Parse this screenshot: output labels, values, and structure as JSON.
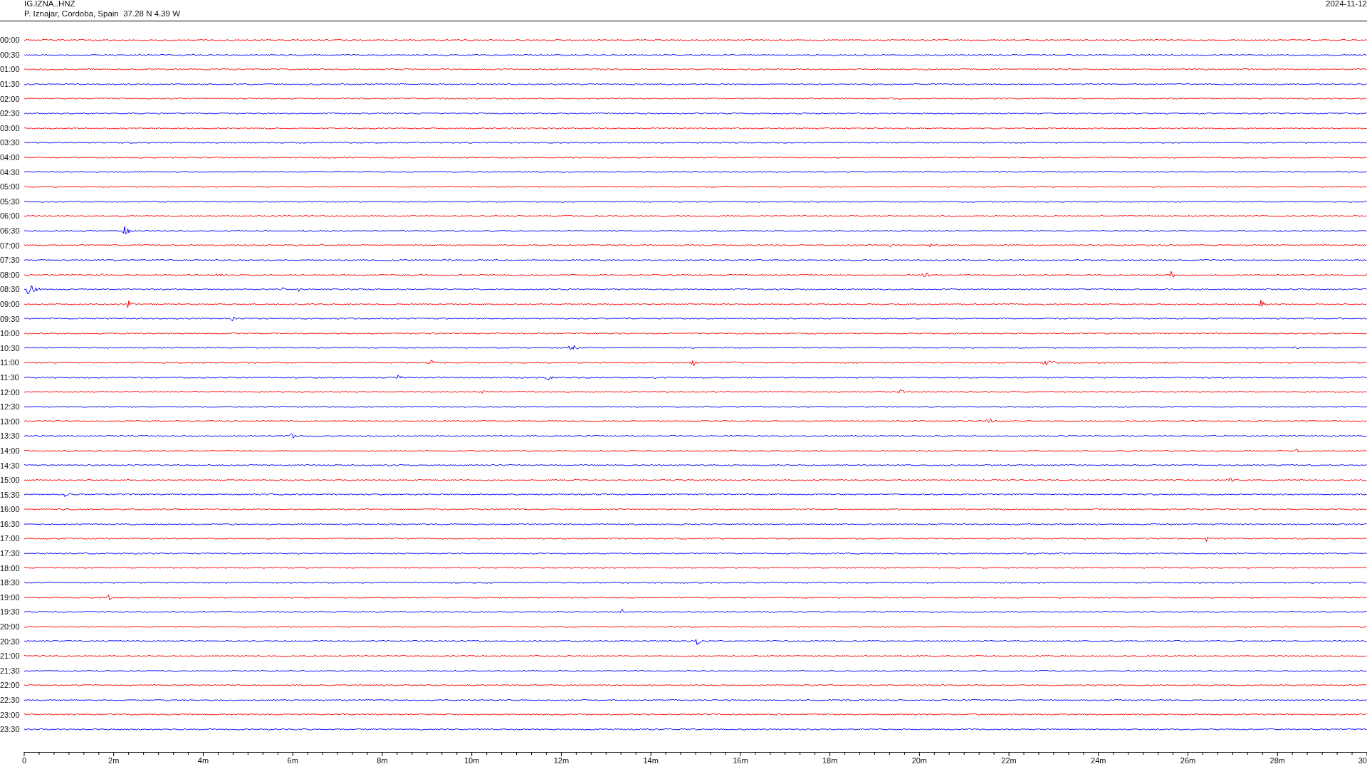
{
  "header": {
    "station": "IG.IZNA..HNZ",
    "location": "P. Iznajar, Cordoba, Spain  37.28 N 4.39 W",
    "date": "2024-11-12"
  },
  "rows": [
    {
      "time": "00:00",
      "color": "#ff0000"
    },
    {
      "time": "00:30",
      "color": "#0000ff"
    },
    {
      "time": "01:00",
      "color": "#ff0000"
    },
    {
      "time": "01:30",
      "color": "#0000ff"
    },
    {
      "time": "02:00",
      "color": "#ff0000"
    },
    {
      "time": "02:30",
      "color": "#0000ff"
    },
    {
      "time": "03:00",
      "color": "#ff0000"
    },
    {
      "time": "03:30",
      "color": "#0000ff"
    },
    {
      "time": "04:00",
      "color": "#ff0000"
    },
    {
      "time": "04:30",
      "color": "#0000ff"
    },
    {
      "time": "05:00",
      "color": "#ff0000"
    },
    {
      "time": "05:30",
      "color": "#0000ff"
    },
    {
      "time": "06:00",
      "color": "#ff0000"
    },
    {
      "time": "06:30",
      "color": "#0000ff"
    },
    {
      "time": "07:00",
      "color": "#ff0000"
    },
    {
      "time": "07:30",
      "color": "#0000ff"
    },
    {
      "time": "08:00",
      "color": "#ff0000"
    },
    {
      "time": "08:30",
      "color": "#0000ff"
    },
    {
      "time": "09:00",
      "color": "#ff0000"
    },
    {
      "time": "09:30",
      "color": "#0000ff"
    },
    {
      "time": "10:00",
      "color": "#ff0000"
    },
    {
      "time": "10:30",
      "color": "#0000ff"
    },
    {
      "time": "11:00",
      "color": "#ff0000"
    },
    {
      "time": "11:30",
      "color": "#0000ff"
    },
    {
      "time": "12:00",
      "color": "#ff0000"
    },
    {
      "time": "12:30",
      "color": "#0000ff"
    },
    {
      "time": "13:00",
      "color": "#ff0000"
    },
    {
      "time": "13:30",
      "color": "#0000ff"
    },
    {
      "time": "14:00",
      "color": "#ff0000"
    },
    {
      "time": "14:30",
      "color": "#0000ff"
    },
    {
      "time": "15:00",
      "color": "#ff0000"
    },
    {
      "time": "15:30",
      "color": "#0000ff"
    },
    {
      "time": "16:00",
      "color": "#ff0000"
    },
    {
      "time": "16:30",
      "color": "#0000ff"
    },
    {
      "time": "17:00",
      "color": "#ff0000"
    },
    {
      "time": "17:30",
      "color": "#0000ff"
    },
    {
      "time": "18:00",
      "color": "#ff0000"
    },
    {
      "time": "18:30",
      "color": "#0000ff"
    },
    {
      "time": "19:00",
      "color": "#ff0000"
    },
    {
      "time": "19:30",
      "color": "#0000ff"
    },
    {
      "time": "20:00",
      "color": "#ff0000"
    },
    {
      "time": "20:30",
      "color": "#0000ff"
    },
    {
      "time": "21:00",
      "color": "#ff0000"
    },
    {
      "time": "21:30",
      "color": "#0000ff"
    },
    {
      "time": "22:00",
      "color": "#ff0000"
    },
    {
      "time": "22:30",
      "color": "#0000ff"
    },
    {
      "time": "23:00",
      "color": "#ff0000"
    },
    {
      "time": "23:30",
      "color": "#0000ff"
    }
  ],
  "axis": {
    "ticks": [
      "0",
      "2m",
      "4m",
      "6m",
      "8m",
      "10m",
      "12m",
      "14m",
      "16m",
      "18m",
      "20m",
      "22m",
      "24m",
      "26m",
      "28m",
      "30"
    ]
  }
}
